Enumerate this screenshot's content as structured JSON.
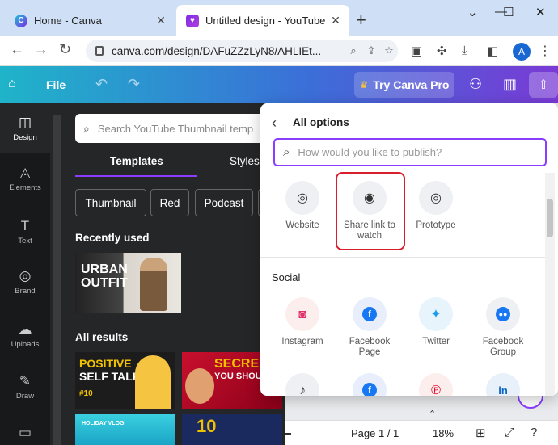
{
  "browser": {
    "tabs": [
      {
        "title": "Home - Canva",
        "favicon": "canva-icon"
      },
      {
        "title": "Untitled design - YouTube Th",
        "favicon": "canva-design-icon"
      }
    ],
    "new_tab": "+",
    "window_controls": {
      "minimize": "—",
      "maximize": "☐",
      "close": "✕"
    },
    "url": "canva.com/design/DAFuZZzLyN8/AHLIEt...",
    "avatar_letter": "A"
  },
  "canva_header": {
    "file_label": "File",
    "try_pro_label": "Try Canva Pro"
  },
  "rail": {
    "items": [
      {
        "label": "Design",
        "icon": "layout-icon"
      },
      {
        "label": "Elements",
        "icon": "shapes-icon"
      },
      {
        "label": "Text",
        "icon": "text-icon"
      },
      {
        "label": "Brand",
        "icon": "brand-icon"
      },
      {
        "label": "Uploads",
        "icon": "upload-icon"
      },
      {
        "label": "Draw",
        "icon": "draw-icon"
      }
    ]
  },
  "panel": {
    "search_placeholder": "Search YouTube Thumbnail temp",
    "tabs": [
      {
        "label": "Templates"
      },
      {
        "label": "Styles"
      }
    ],
    "chips": [
      {
        "label": "Thumbnail"
      },
      {
        "label": "Red"
      },
      {
        "label": "Podcast"
      }
    ],
    "recently_used": "Recently used",
    "all_results": "All results",
    "thumbs": {
      "urban": "URBAN OUTFIT",
      "self_a": "POSITIVE",
      "self_b": "SELF TALK",
      "self_num": "#10",
      "secret": "SECRE",
      "secret_sub": "YOU SHOU",
      "vlog": "HOLIDAY VLOG",
      "plays": "10"
    }
  },
  "canvas": {
    "page_label": "Page 1 / 1",
    "zoom": "18%"
  },
  "share_menu": {
    "title": "All options",
    "search_placeholder": "How would you like to publish?",
    "top_options": [
      {
        "label": "Website",
        "icon": "website-icon"
      },
      {
        "label": "Share link to watch",
        "icon": "eye-icon"
      },
      {
        "label": "Prototype",
        "icon": "prototype-icon"
      }
    ],
    "social_title": "Social",
    "social_options": [
      {
        "label": "Instagram",
        "icon": "instagram-icon"
      },
      {
        "label": "Facebook Page",
        "icon": "facebook-icon"
      },
      {
        "label": "Twitter",
        "icon": "twitter-icon"
      },
      {
        "label": "Facebook Group",
        "icon": "facebook-group-icon"
      }
    ],
    "more_social": [
      {
        "icon": "tiktok-icon"
      },
      {
        "icon": "facebook-messenger-icon"
      },
      {
        "icon": "pinterest-icon"
      },
      {
        "icon": "linkedin-icon"
      }
    ],
    "highlight_color": "#d91e2e",
    "accent_color": "#8b3dff"
  }
}
